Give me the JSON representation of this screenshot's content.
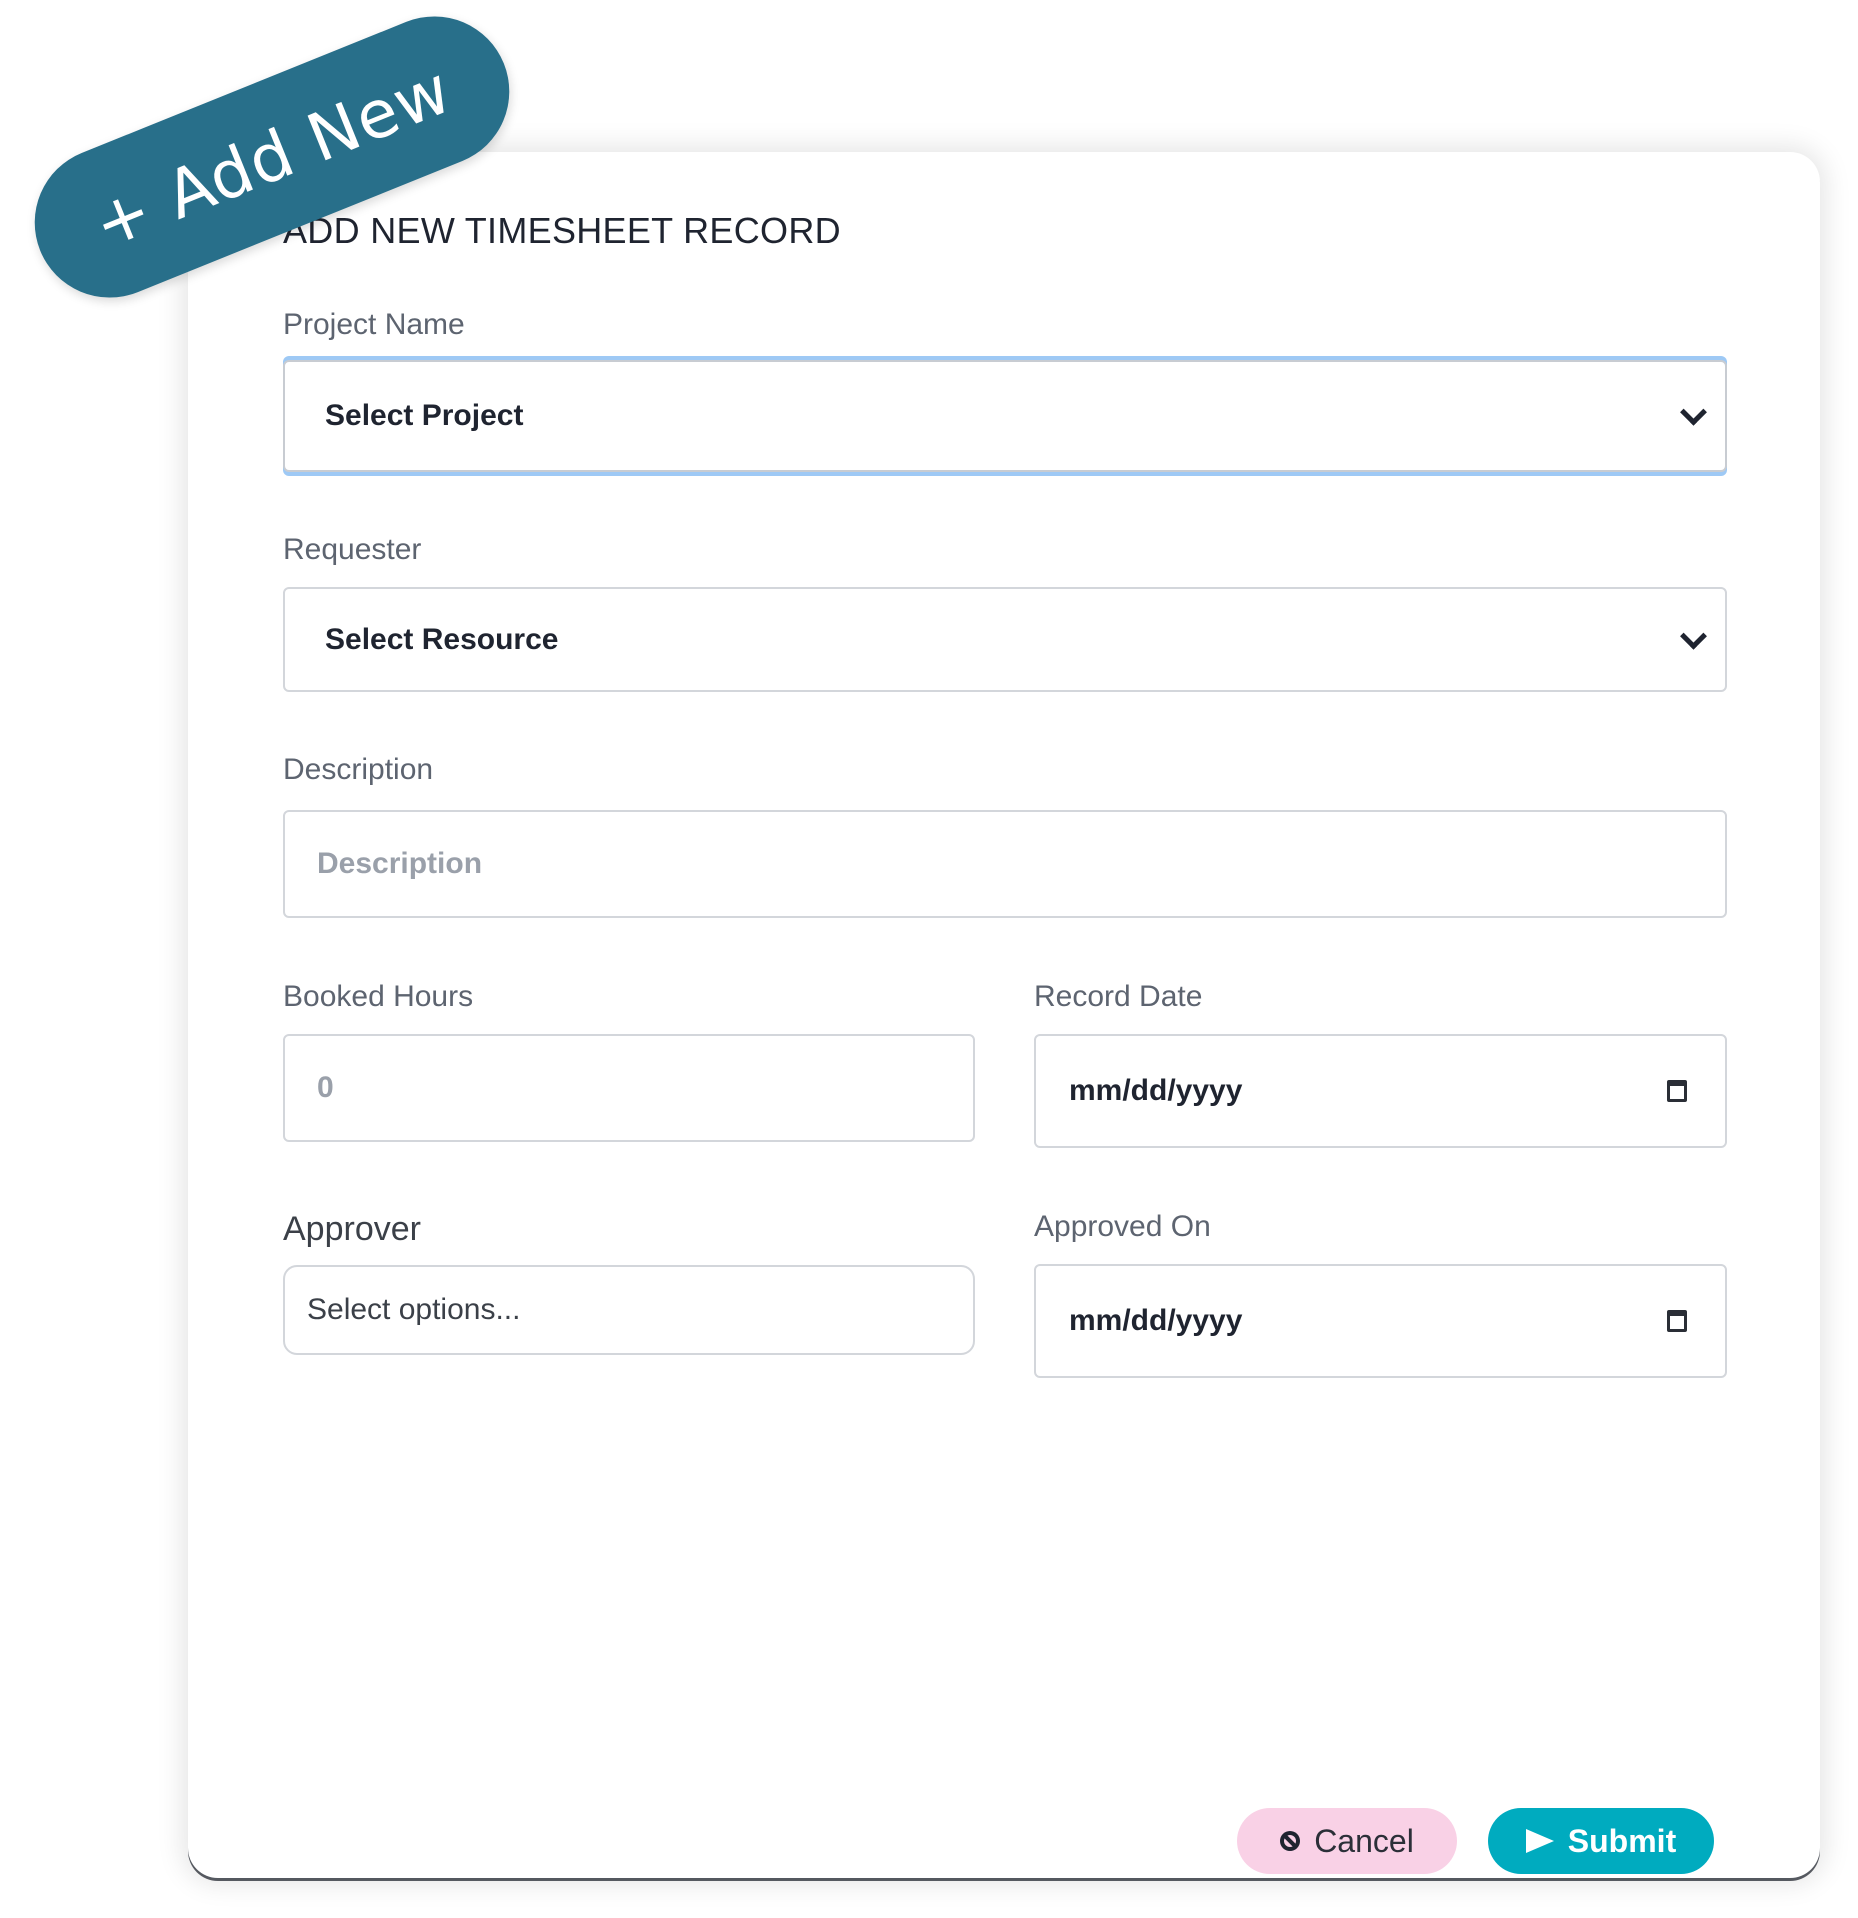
{
  "badge": {
    "label": "+ Add New",
    "color": "#286f8a"
  },
  "form": {
    "title": "ADD NEW TIMESHEET RECORD",
    "project": {
      "label": "Project Name",
      "value": "Select Project"
    },
    "requester": {
      "label": "Requester",
      "value": "Select Resource"
    },
    "description": {
      "label": "Description",
      "placeholder": "Description",
      "value": ""
    },
    "booked_hours": {
      "label": "Booked Hours",
      "placeholder": "0",
      "value": ""
    },
    "record_date": {
      "label": "Record Date",
      "value": "mm/dd/yyyy"
    },
    "approver": {
      "label": "Approver",
      "placeholder": "Select options..."
    },
    "approved_on": {
      "label": "Approved On",
      "value": "mm/dd/yyyy"
    }
  },
  "actions": {
    "cancel": {
      "label": "Cancel",
      "color": "#f9d1e6",
      "icon": "ban-icon"
    },
    "submit": {
      "label": "Submit",
      "color": "#00abbf",
      "icon": "send-icon"
    }
  }
}
